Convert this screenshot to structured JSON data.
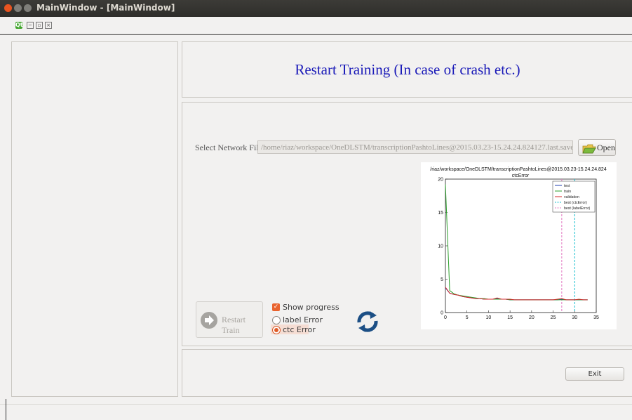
{
  "window": {
    "title": "MainWindow - [MainWindow]"
  },
  "menubar": {
    "icons": [
      "qt-logo-icon",
      "window-icon",
      "restore-icon",
      "close-small-icon"
    ],
    "qt_label": "Qt"
  },
  "header": {
    "title": "Restart Training (In case of crash etc.)"
  },
  "network": {
    "label": "Select Network File",
    "path": "/home/riaz/workspace/OneDLSTM/transcriptionPashtoLines@2015.03.23-15.24.24.824127.last.save",
    "open_label": "Open"
  },
  "controls": {
    "restart_label": "Restart Train",
    "show_progress_label": "Show progress",
    "show_progress_checked": true,
    "label_error_label": "label Error",
    "ctc_error_label": "ctc Error",
    "selected_error": "ctc Error"
  },
  "footer": {
    "exit_label": "Exit"
  },
  "colors": {
    "accent": "#e95420",
    "heading": "#1a1ab8",
    "refresh_icon": "#1c4f85"
  },
  "chart_data": {
    "type": "line",
    "title": "/riaz/workspace/OneDLSTM/transcriptionPashtoLines@2015.03.23-15.24.24.824",
    "subtitle": "ctcError",
    "xlim": [
      0,
      35
    ],
    "ylim": [
      0,
      20
    ],
    "xticks": [
      0,
      5,
      10,
      15,
      20,
      25,
      30,
      35
    ],
    "yticks": [
      0,
      5,
      10,
      15,
      20
    ],
    "legend_position": "top-right",
    "series": [
      {
        "name": "test",
        "color": "#1f3fb0",
        "x": [
          0,
          1,
          2,
          3,
          4,
          5,
          6,
          7,
          8,
          9,
          10,
          11,
          12,
          13,
          14,
          15,
          16,
          17,
          18,
          19,
          20,
          21,
          22,
          23,
          24,
          25,
          26,
          27,
          28,
          29,
          30,
          31,
          32,
          33
        ],
        "y": [
          3.7,
          2.9,
          2.7,
          2.6,
          2.4,
          2.3,
          2.2,
          2.1,
          2.1,
          2.0,
          2.0,
          2.0,
          2.1,
          2.0,
          2.0,
          1.9,
          1.9,
          1.9,
          1.9,
          1.9,
          1.9,
          1.9,
          1.9,
          1.9,
          1.9,
          1.9,
          1.9,
          2.0,
          1.9,
          1.9,
          1.9,
          1.9,
          1.9,
          1.9
        ]
      },
      {
        "name": "train",
        "color": "#2ca02c",
        "x": [
          0,
          1,
          2,
          3,
          4,
          5,
          6,
          7,
          8,
          9,
          10,
          11,
          12,
          13,
          14,
          15,
          16,
          17,
          18,
          19,
          20,
          21,
          22,
          23,
          24,
          25,
          26,
          27,
          28,
          29,
          30,
          31,
          32,
          33
        ],
        "y": [
          19.2,
          3.3,
          2.8,
          2.6,
          2.5,
          2.4,
          2.3,
          2.2,
          2.1,
          2.1,
          2.0,
          2.0,
          2.0,
          2.0,
          2.0,
          1.9,
          1.9,
          1.9,
          1.9,
          1.9,
          1.9,
          1.9,
          1.9,
          1.9,
          1.9,
          1.9,
          1.9,
          1.9,
          1.9,
          1.9,
          1.9,
          1.9,
          1.9,
          1.9
        ]
      },
      {
        "name": "validation",
        "color": "#d62728",
        "x": [
          0,
          1,
          2,
          3,
          4,
          5,
          6,
          7,
          8,
          9,
          10,
          11,
          12,
          13,
          14,
          15,
          16,
          17,
          18,
          19,
          20,
          21,
          22,
          23,
          24,
          25,
          26,
          27,
          28,
          29,
          30,
          31,
          32,
          33
        ],
        "y": [
          3.8,
          2.9,
          2.7,
          2.6,
          2.4,
          2.3,
          2.2,
          2.1,
          2.1,
          2.0,
          2.0,
          2.0,
          2.2,
          2.0,
          2.0,
          2.0,
          1.9,
          1.9,
          1.9,
          1.9,
          1.9,
          1.9,
          1.9,
          1.9,
          1.9,
          1.9,
          2.0,
          2.1,
          1.9,
          1.9,
          1.9,
          2.0,
          1.9,
          1.9
        ]
      }
    ],
    "vlines": [
      {
        "name": "best (ctcError)",
        "x": 30,
        "color": "#17becf"
      },
      {
        "name": "best (labelError)",
        "x": 27,
        "color": "#e377c2"
      }
    ]
  }
}
